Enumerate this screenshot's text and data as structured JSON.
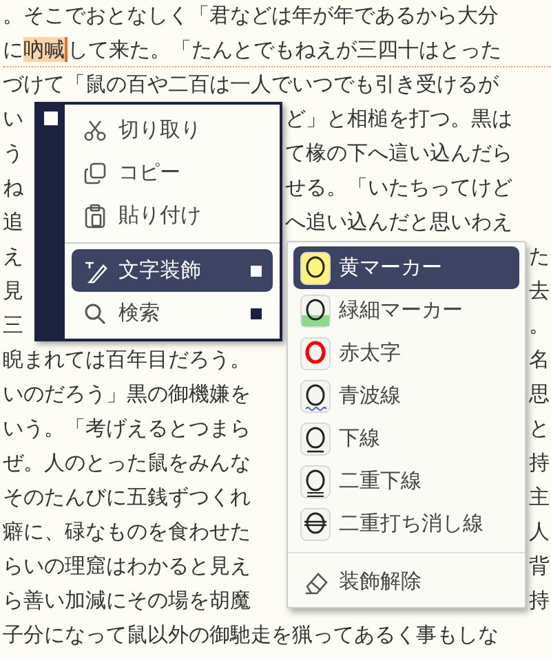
{
  "lines": [
    {
      "current": false,
      "parts": [
        {
          "text": "。そこでおとなしく「君などは年が年であるから大分",
          "selected": false
        }
      ]
    },
    {
      "current": true,
      "parts": [
        {
          "text": "に",
          "selected": false
        },
        {
          "text": "吶喊",
          "selected": true
        },
        {
          "text": "して来た。「たんとでもねえが三四十はとった",
          "selected": false
        }
      ]
    },
    {
      "current": false,
      "parts": [
        {
          "text": "づけて「鼠の百や二百は一人でいつでも引き受けるが",
          "selected": false
        }
      ]
    },
    {
      "current": false,
      "parts": [
        {
          "text": "い",
          "selected": false
        }
      ],
      "right": "ど」と相槌を打つ。黒は"
    },
    {
      "current": false,
      "parts": [
        {
          "text": "う",
          "selected": false
        }
      ],
      "right": "て椽の下へ這い込んだら"
    },
    {
      "current": false,
      "parts": [
        {
          "text": "ね",
          "selected": false
        }
      ],
      "right": "せる。「いたちってけど"
    },
    {
      "current": false,
      "parts": [
        {
          "text": "追",
          "selected": false
        }
      ],
      "right": "へ追い込んだと思いわえ"
    },
    {
      "current": false,
      "parts": [
        {
          "text": "え",
          "selected": false
        }
      ],
      "right": "た"
    },
    {
      "current": false,
      "parts": [
        {
          "text": "見",
          "selected": false
        }
      ],
      "right": "去"
    },
    {
      "current": false,
      "parts": [
        {
          "text": "三",
          "selected": false
        }
      ],
      "right": "。"
    },
    {
      "current": false,
      "parts": [
        {
          "text": "睨まれては百年目だろう。",
          "selected": false
        }
      ],
      "right": "名"
    },
    {
      "current": false,
      "parts": [
        {
          "text": "いのだろう」黒の御機嫌を",
          "selected": false
        }
      ],
      "right": "思"
    },
    {
      "current": false,
      "parts": [
        {
          "text": "いう。「考げえるとつまら",
          "selected": false
        }
      ],
      "right": "と"
    },
    {
      "current": false,
      "parts": [
        {
          "text": "ぜ。人のとった鼠をみんな",
          "selected": false
        }
      ],
      "right": "持"
    },
    {
      "current": false,
      "parts": [
        {
          "text": "そのたんびに五銭ずつくれ",
          "selected": false
        }
      ],
      "right": "主"
    },
    {
      "current": false,
      "parts": [
        {
          "text": "癖に、碌なものを食わせた",
          "selected": false
        }
      ],
      "right": "人"
    },
    {
      "current": false,
      "parts": [
        {
          "text": "らいの理窟はわかると見え",
          "selected": false
        }
      ],
      "right": "背"
    },
    {
      "current": false,
      "parts": [
        {
          "text": "ら善い加減にその場を胡魔",
          "selected": false
        }
      ],
      "right": "持"
    },
    {
      "current": false,
      "parts": [
        {
          "text": "子分になって鼠以外の御馳走を猟ってあるく事もしな",
          "selected": false
        }
      ]
    }
  ],
  "menu": {
    "groups": [
      [
        {
          "label": "切り取り",
          "kind": "cut",
          "selected": false,
          "submenu": false
        },
        {
          "label": "コピー",
          "kind": "copy",
          "selected": false,
          "submenu": false
        },
        {
          "label": "貼り付け",
          "kind": "paste",
          "selected": false,
          "submenu": false
        }
      ],
      [
        {
          "label": "文字装飾",
          "kind": "decorate",
          "selected": true,
          "submenu": true
        },
        {
          "label": "検索",
          "kind": "search",
          "selected": false,
          "submenu": true
        }
      ]
    ]
  },
  "submenu": {
    "groups": [
      [
        {
          "label": "黄マーカー",
          "kind": "highlight",
          "color": "#fff47a",
          "selected": true
        },
        {
          "label": "緑細マーカー",
          "kind": "thin-marker",
          "color": "#8fd98f",
          "selected": false
        },
        {
          "label": "赤太字",
          "kind": "bold",
          "color": "#ff0000",
          "selected": false
        },
        {
          "label": "青波線",
          "kind": "wavy",
          "color": "#4455ee",
          "selected": false
        },
        {
          "label": "下線",
          "kind": "underline",
          "selected": false
        },
        {
          "label": "二重下線",
          "kind": "double-underline",
          "selected": false
        },
        {
          "label": "二重打ち消し線",
          "kind": "double-strike",
          "selected": false
        }
      ],
      [
        {
          "label": "装飾解除",
          "kind": "clear",
          "selected": false
        }
      ]
    ]
  }
}
